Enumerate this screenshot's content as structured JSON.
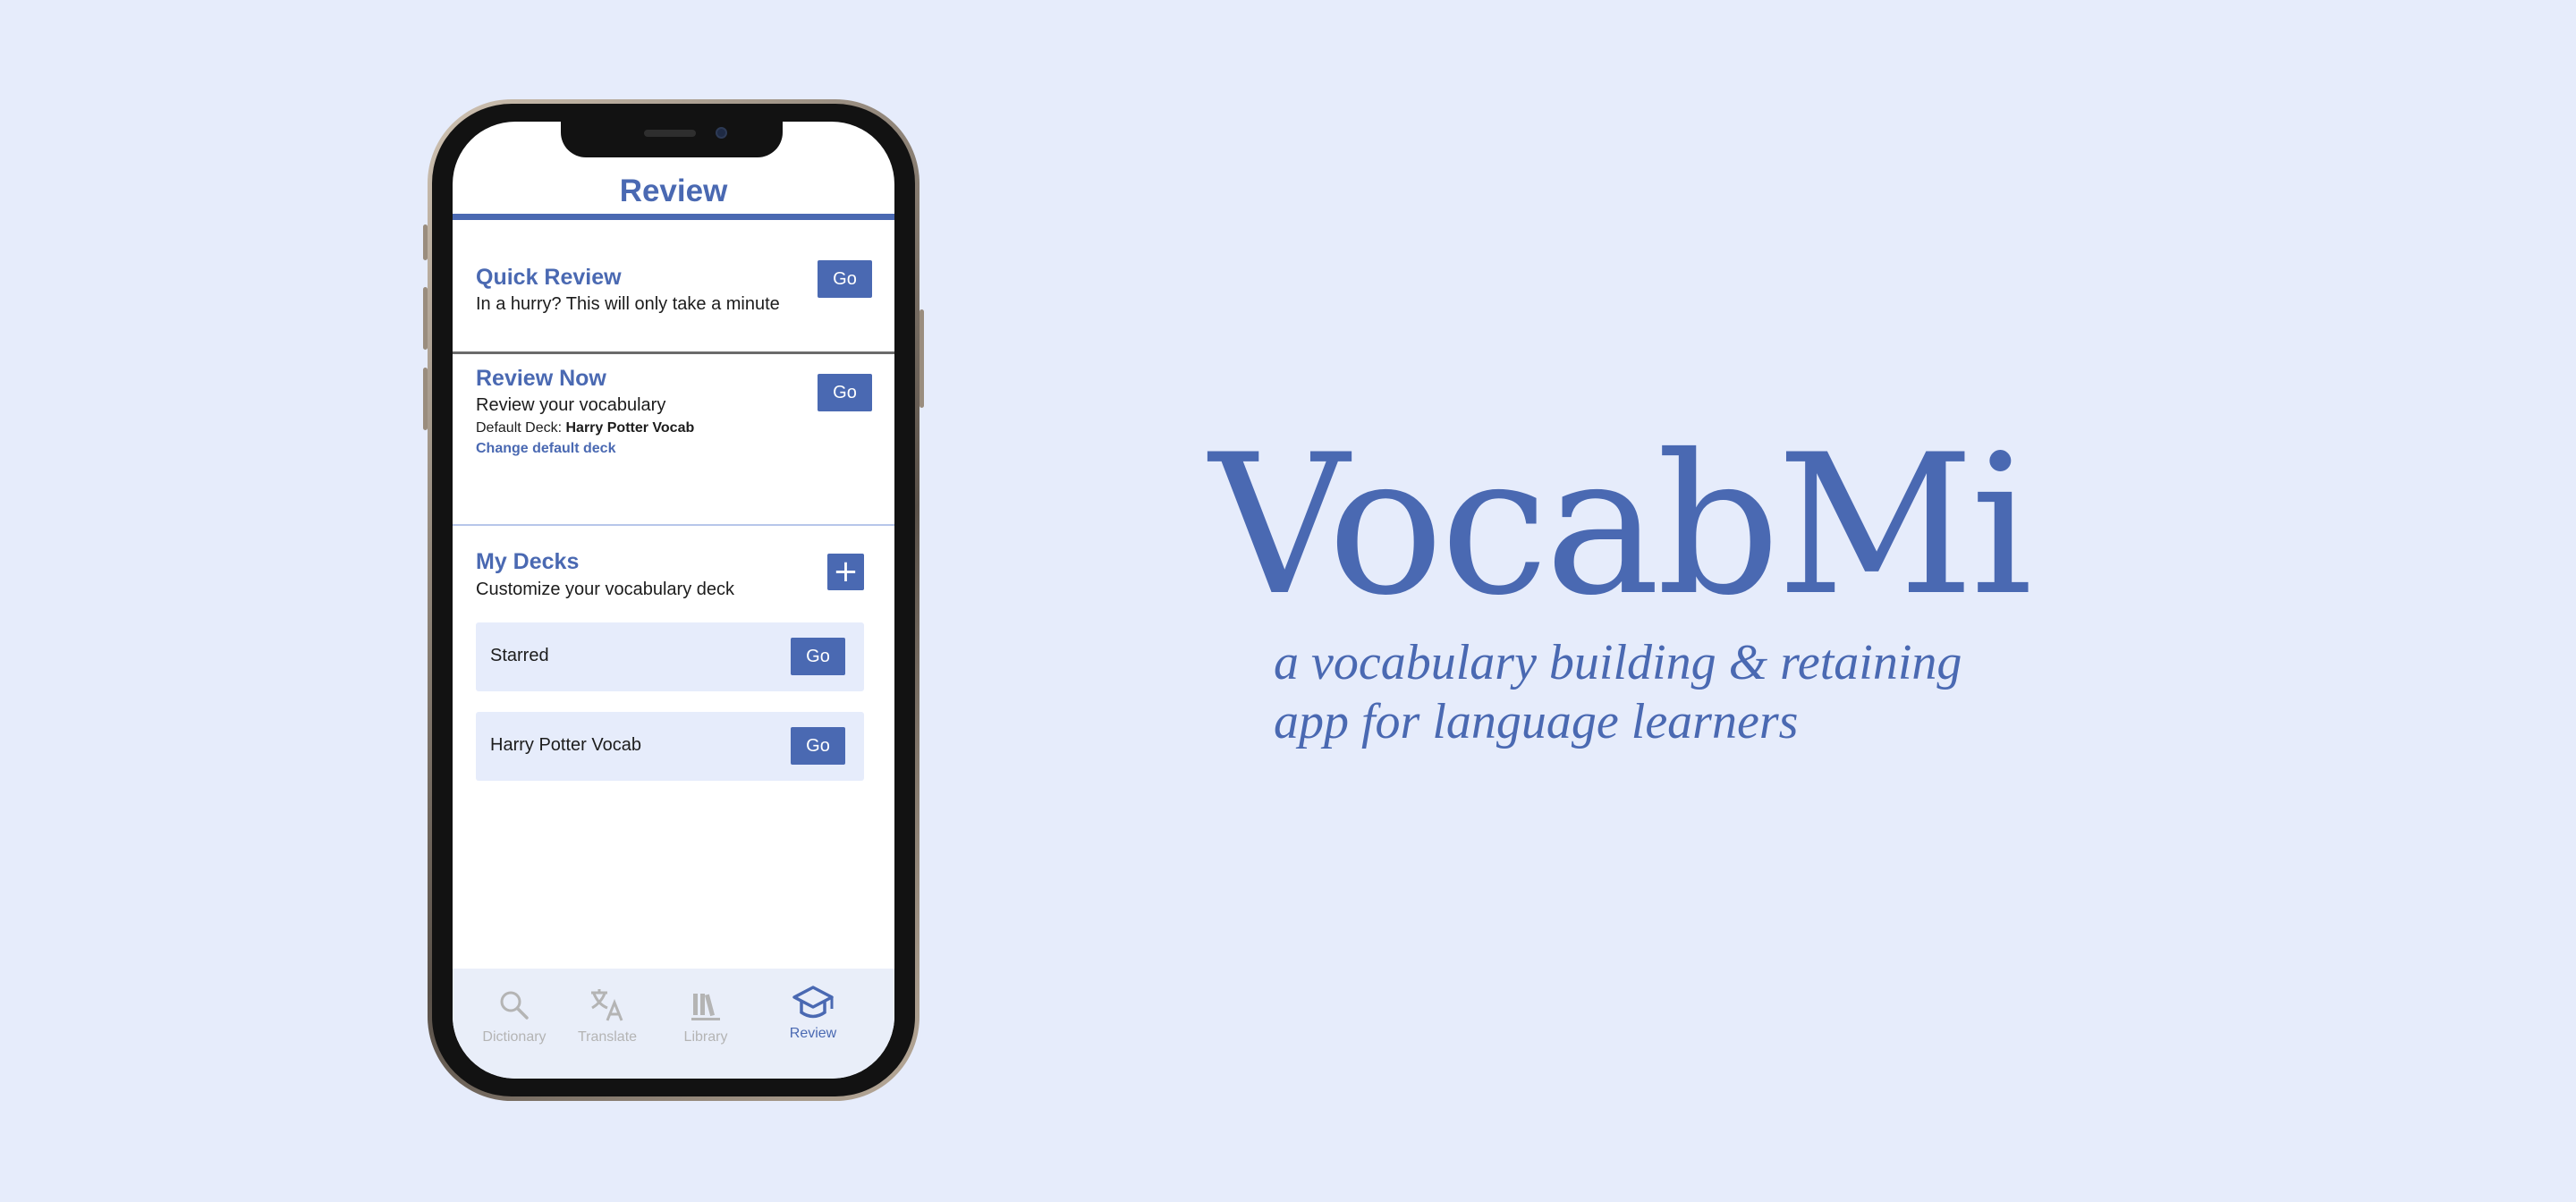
{
  "app": {
    "header_title": "Review",
    "quick_review": {
      "title": "Quick Review",
      "description": "In a hurry? This will only take a minute",
      "go_label": "Go"
    },
    "review_now": {
      "title": "Review Now",
      "description": "Review your vocabulary",
      "default_deck_label": "Default Deck:",
      "default_deck_value": "Harry Potter Vocab",
      "change_link": "Change default deck",
      "go_label": "Go"
    },
    "my_decks": {
      "title": "My Decks",
      "description": "Customize your vocabulary deck",
      "add_icon": "plus-icon",
      "decks": [
        {
          "name": "Starred",
          "go_label": "Go"
        },
        {
          "name": "Harry Potter Vocab",
          "go_label": "Go"
        }
      ]
    },
    "tabbar": [
      {
        "label": "Dictionary",
        "icon": "search-icon",
        "active": false
      },
      {
        "label": "Translate",
        "icon": "translate-icon",
        "active": false
      },
      {
        "label": "Library",
        "icon": "library-icon",
        "active": false
      },
      {
        "label": "Review",
        "icon": "graduation-cap-icon",
        "active": true
      }
    ]
  },
  "hero": {
    "brand": "VocabMi",
    "tagline_line1": "a vocabulary building & retaining",
    "tagline_line2": "app for language learners"
  },
  "colors": {
    "background": "#e6ecfb",
    "accent": "#4a69b2",
    "inactive": "#b4b4b4"
  }
}
